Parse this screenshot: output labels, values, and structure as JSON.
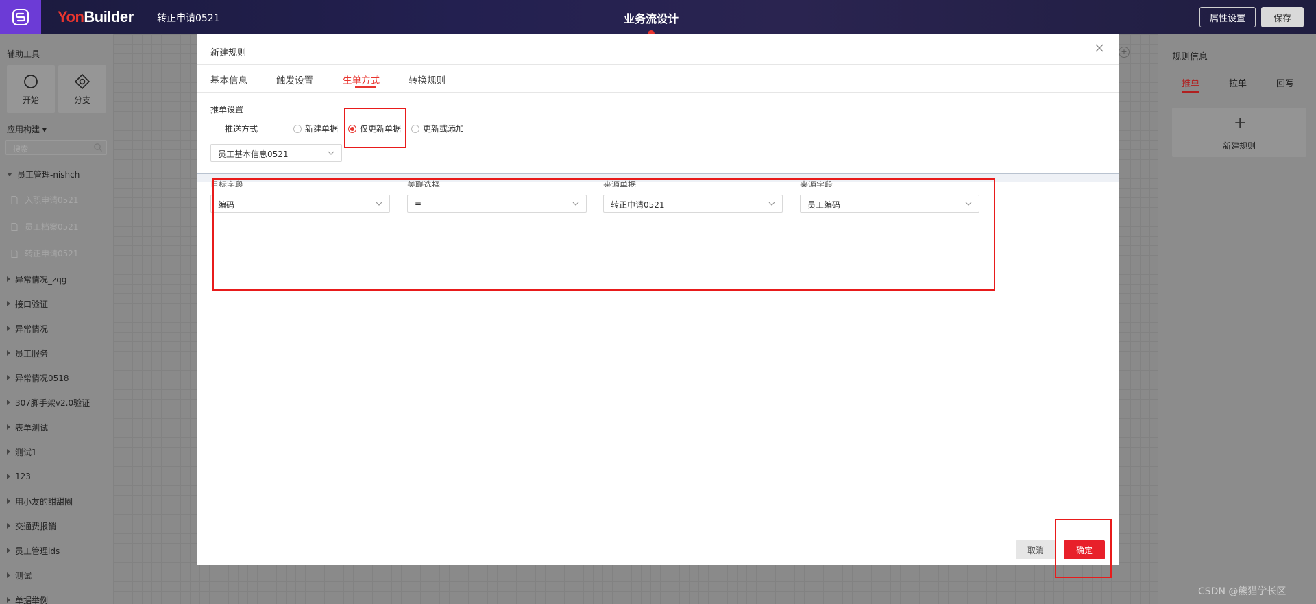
{
  "topbar": {
    "brand_prefix": "Yon",
    "brand_suffix": "Builder",
    "doc_name": "转正申请0521",
    "center_title": "业务流设计",
    "props_button": "属性设置",
    "save_button": "保存"
  },
  "sidebar": {
    "title": "辅助工具",
    "tools": [
      {
        "label": "开始",
        "icon": "circle-icon"
      },
      {
        "label": "分支",
        "icon": "diamond-icon"
      }
    ],
    "section_label": "应用构建 ▾",
    "search_placeholder": "搜索",
    "tree": {
      "open_group": "员工管理-nishch",
      "children": [
        "入职申请0521",
        "员工档案0521",
        "转正申请0521"
      ],
      "groups": [
        "异常情况_zqg",
        "接口验证",
        "异常情况",
        "员工服务",
        "异常情况0518",
        "307脚手架v2.0验证",
        "表单测试",
        "测试1",
        "123",
        "用小友的甜甜圈",
        "交通费报销",
        "员工管理lds",
        "测试",
        "单据举例"
      ]
    }
  },
  "rightpanel": {
    "title": "规则信息",
    "tabs": [
      "推单",
      "拉单",
      "回写"
    ],
    "active_tab": "推单",
    "card_label": "新建规则"
  },
  "modal": {
    "title": "新建规则",
    "tabs": [
      "基本信息",
      "触发设置",
      "生单方式",
      "转换规则"
    ],
    "active_tab": "生单方式",
    "push_settings": {
      "title": "推单设置",
      "method_label": "推送方式",
      "options": [
        "新建单据",
        "仅更新单据",
        "更新或添加"
      ],
      "selected": "仅更新单据",
      "target_doc": "员工基本信息0521"
    },
    "mapping": {
      "columns": [
        "目标字段",
        "关联选择",
        "来源单据",
        "来源字段"
      ],
      "row": [
        "编码",
        "=",
        "转正申请0521",
        "员工编码"
      ]
    },
    "cancel_button": "取消",
    "ok_button": "确定"
  },
  "watermark": "CSDN @熊猫学长区"
}
